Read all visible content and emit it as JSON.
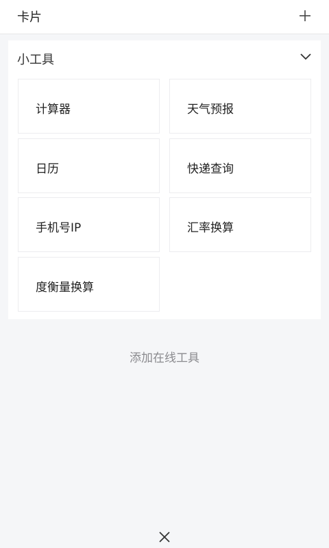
{
  "header": {
    "title": "卡片",
    "add_icon": "plus-icon"
  },
  "panel": {
    "title": "小工具",
    "collapse_icon": "chevron-down-icon",
    "tools": [
      {
        "label": "计算器"
      },
      {
        "label": "天气预报"
      },
      {
        "label": "日历"
      },
      {
        "label": "快递查询"
      },
      {
        "label": "手机号IP"
      },
      {
        "label": "汇率换算"
      },
      {
        "label": "度衡量换算"
      }
    ]
  },
  "footer": {
    "add_online_label": "添加在线工具",
    "close_icon": "close-icon"
  }
}
